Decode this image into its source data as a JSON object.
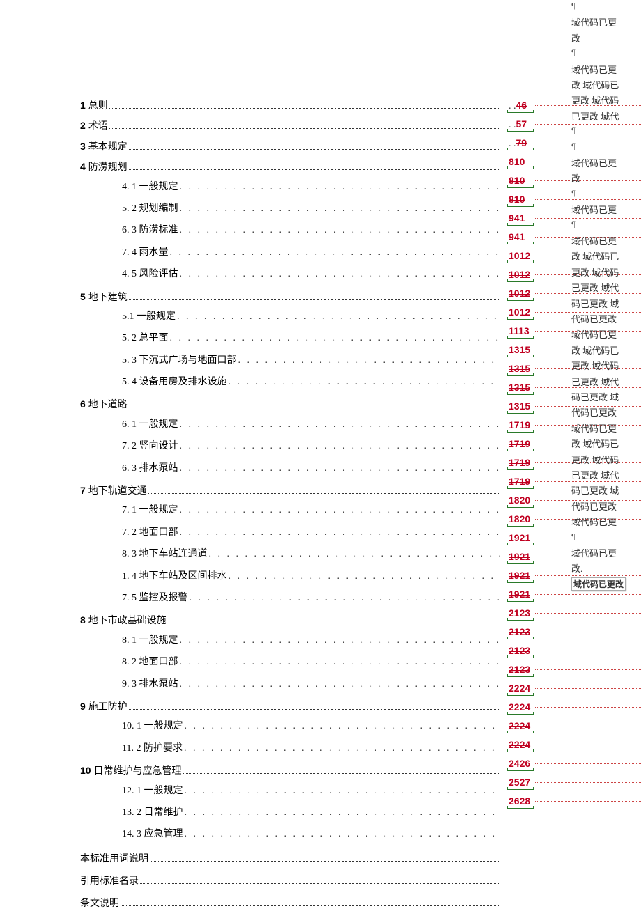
{
  "toc": [
    {
      "type": "chapter",
      "num": "1",
      "label": "总则",
      "page": "46",
      "strike": true
    },
    {
      "type": "chapter",
      "num": "2",
      "label": "术语",
      "page": "57",
      "strike": true
    },
    {
      "type": "chapter",
      "num": "3",
      "label": "基本规定",
      "page": "79",
      "strike": true
    },
    {
      "type": "chapter",
      "num": "4",
      "label": "防涝规划",
      "page": "810",
      "strike": false
    },
    {
      "type": "sub",
      "num": "4.",
      "sub": "1",
      "label": "一般规定",
      "page": "810",
      "strike": true
    },
    {
      "type": "sub",
      "num": "5.",
      "sub": "2",
      "label": "规划编制",
      "page": "810",
      "strike": true
    },
    {
      "type": "sub",
      "num": "6.",
      "sub": "3",
      "label": "防涝标准",
      "page": "941",
      "strike": true
    },
    {
      "type": "sub",
      "num": "7.",
      "sub": "4",
      "label": "雨水量",
      "page": "941",
      "strike": true
    },
    {
      "type": "sub",
      "num": "4.",
      "sub": "5",
      "label": "风险评估",
      "page": "1012",
      "strike": false
    },
    {
      "type": "chapter",
      "num": "5",
      "label": "地下建筑",
      "page": "1012",
      "strike": true
    },
    {
      "type": "sub",
      "num": "5.1",
      "sub": "",
      "label": "一般规定",
      "page": "1012",
      "strike": true
    },
    {
      "type": "sub",
      "num": "5.",
      "sub": "2",
      "label": "总平面",
      "page": "1012",
      "strike": true
    },
    {
      "type": "sub",
      "num": "5.",
      "sub": "3",
      "label": "下沉式广场与地面口部",
      "page": "1113",
      "strike": true
    },
    {
      "type": "sub",
      "num": "5.",
      "sub": "4",
      "label": "设备用房及排水设施",
      "page": "1315",
      "strike": false
    },
    {
      "type": "chapter",
      "num": "6",
      "label": "地下道路",
      "page": "1315",
      "strike": true
    },
    {
      "type": "sub",
      "num": "6.",
      "sub": "1",
      "label": "一般规定",
      "page": "1315",
      "strike": true
    },
    {
      "type": "sub",
      "num": "7.",
      "sub": "2",
      "label": "竖向设计",
      "page": "1315",
      "strike": true
    },
    {
      "type": "sub",
      "num": "6.",
      "sub": "3",
      "label": "排水泵站",
      "page": "1719",
      "strike": false
    },
    {
      "type": "chapter",
      "num": "7",
      "label": "地下轨道交通",
      "page": "1719",
      "strike": true
    },
    {
      "type": "sub",
      "num": "7.",
      "sub": "1",
      "label": "一般规定",
      "page": "1719",
      "strike": true
    },
    {
      "type": "sub",
      "num": "7.",
      "sub": "2",
      "label": "地面口部",
      "page": "1719",
      "strike": true
    },
    {
      "type": "sub",
      "num": "8.",
      "sub": "3",
      "label": "地下车站连通道",
      "page": "1820",
      "strike": true
    },
    {
      "type": "sub",
      "num": "1.",
      "sub": "4",
      "label": "地下车站及区间排水",
      "page": "1820",
      "strike": true
    },
    {
      "type": "sub",
      "num": "7.",
      "sub": "5",
      "label": "监控及报警",
      "page": "1921",
      "strike": false
    },
    {
      "type": "chapter",
      "num": "8",
      "label": "地下市政基础设施",
      "page": "1921",
      "strike": true
    },
    {
      "type": "sub",
      "num": "8.",
      "sub": "1",
      "label": "一般规定",
      "page": "1921",
      "strike": true
    },
    {
      "type": "sub",
      "num": "8.",
      "sub": "2",
      "label": "地面口部",
      "page": "1921",
      "strike": true
    },
    {
      "type": "sub",
      "num": "9.",
      "sub": "3",
      "label": "排水泵站",
      "page": "2123",
      "strike": false
    },
    {
      "type": "chapter",
      "num": "9",
      "label": "施工防护",
      "page": "2123",
      "strike": true
    },
    {
      "type": "sub",
      "num": "10.",
      "sub": "1",
      "label": "一般规定",
      "page": "2123",
      "strike": true
    },
    {
      "type": "sub",
      "num": "11.",
      "sub": "2",
      "label": "防护要求",
      "page": "2123",
      "strike": true
    },
    {
      "type": "chapter",
      "num": "10",
      "label": "日常维护与应急管理",
      "page": "2224",
      "strike": false
    },
    {
      "type": "sub",
      "num": "12.",
      "sub": "1",
      "label": "一般规定",
      "page": "2224",
      "strike": true
    },
    {
      "type": "sub",
      "num": "13.",
      "sub": "2",
      "label": "日常维护",
      "page": "2224",
      "strike": true
    },
    {
      "type": "sub",
      "num": "14.",
      "sub": "3",
      "label": "应急管理",
      "page": "2224",
      "strike": true
    }
  ],
  "plain": [
    {
      "label": "本标准用词说明",
      "page": "2426"
    },
    {
      "label": "引用标准名录",
      "page": "2527"
    },
    {
      "label": "条文说明",
      "page": "2628"
    }
  ],
  "plain_pages": [
    "2426",
    "2527",
    "2628"
  ],
  "annotations": {
    "text_changed": "域代码已更改",
    "text_changed_box": "域代码已更改",
    "marker": "¶",
    "run1": [
      "域代码已更",
      "改"
    ],
    "run2": [
      "域代码已更",
      "改  域代码已",
      "更改  域代码",
      "已更改  域代"
    ],
    "run_small": [
      "域代码已更",
      "改"
    ],
    "run3": [
      "域代码已更",
      "改  域代码已",
      "更改  域代码",
      "已更改  域代",
      "码已更改  域",
      "代码已更改"
    ],
    "run4": [
      "域代码已更",
      "改  域代码已",
      "更改  域代码",
      "已更改  域代",
      "码已更改  域",
      "代码已更改",
      "域代码已更",
      "改  域代码已",
      "更改  域代码",
      "已更改  域代",
      "码已更改  域",
      "代码已更改",
      "域代码已更"
    ],
    "run5": [
      "域代码已更",
      "改"
    ]
  }
}
